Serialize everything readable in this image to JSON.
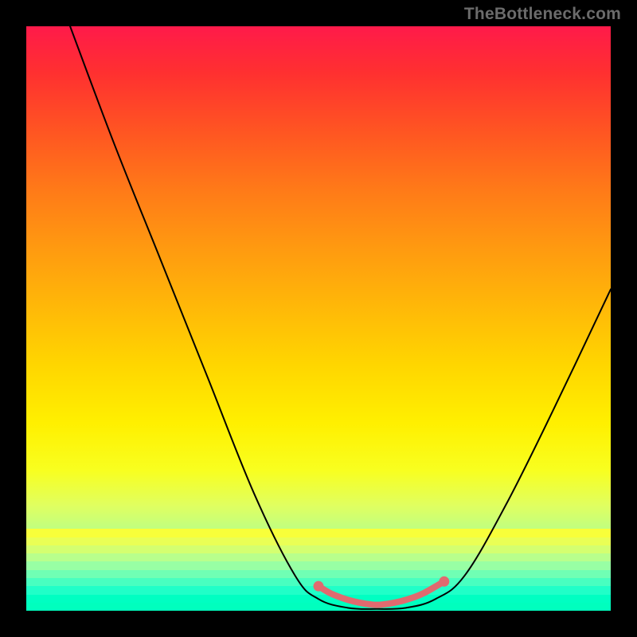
{
  "watermark": "TheBottleneck.com",
  "chart_data": {
    "type": "line",
    "title": "",
    "xlabel": "",
    "ylabel": "",
    "xlim": [
      0,
      100
    ],
    "ylim": [
      0,
      100
    ],
    "grid": false,
    "curve_points": [
      {
        "x": 7.5,
        "y": 100
      },
      {
        "x": 15,
        "y": 80
      },
      {
        "x": 23,
        "y": 60
      },
      {
        "x": 31,
        "y": 40
      },
      {
        "x": 39,
        "y": 20
      },
      {
        "x": 46,
        "y": 6
      },
      {
        "x": 50,
        "y": 2
      },
      {
        "x": 55,
        "y": 0.5
      },
      {
        "x": 60,
        "y": 0.3
      },
      {
        "x": 65,
        "y": 0.5
      },
      {
        "x": 70,
        "y": 2
      },
      {
        "x": 75,
        "y": 6
      },
      {
        "x": 82,
        "y": 18
      },
      {
        "x": 90,
        "y": 34
      },
      {
        "x": 100,
        "y": 55
      }
    ],
    "highlight_points": [
      {
        "x": 50,
        "y": 4.2
      },
      {
        "x": 52,
        "y": 3.0
      },
      {
        "x": 54,
        "y": 2.2
      },
      {
        "x": 56,
        "y": 1.6
      },
      {
        "x": 58,
        "y": 1.2
      },
      {
        "x": 60,
        "y": 1.0
      },
      {
        "x": 62,
        "y": 1.2
      },
      {
        "x": 64,
        "y": 1.6
      },
      {
        "x": 66,
        "y": 2.2
      },
      {
        "x": 68,
        "y": 3.0
      },
      {
        "x": 71.5,
        "y": 5.0
      }
    ],
    "highlight_color": "#e06a6f",
    "curve_color": "#000000",
    "curve_width": 2.0,
    "background_gradient": {
      "top": "#ff1a4a",
      "mid": "#ffe000",
      "bottom": "#00ffbe"
    }
  }
}
